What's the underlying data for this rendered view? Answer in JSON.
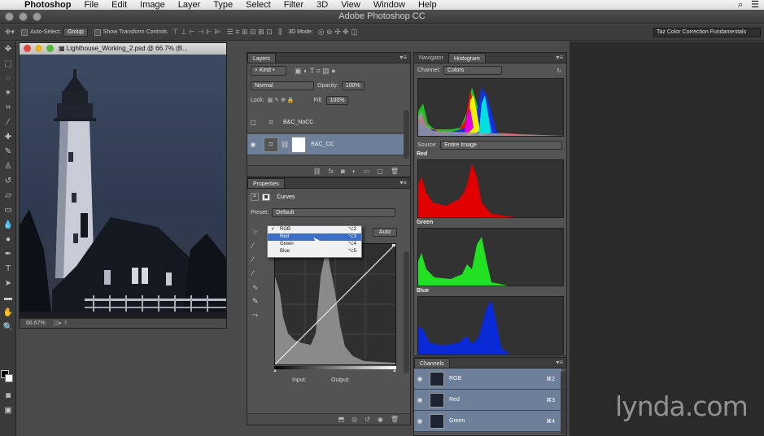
{
  "menubar": {
    "app": "Photoshop",
    "items": [
      "File",
      "Edit",
      "Image",
      "Layer",
      "Type",
      "Select",
      "Filter",
      "3D",
      "View",
      "Window",
      "Help"
    ]
  },
  "app_title": "Adobe Photoshop CC",
  "options": {
    "auto_select_label": "Auto-Select:",
    "auto_select_value": "Group",
    "transform_label": "Show Transform Controls",
    "mode_3d": "3D Mode:",
    "workspace": "Taz Color Correction Fundamentals"
  },
  "document": {
    "title": "Lighthouse_Working_2.psd @ 66.7% (B...",
    "zoom": "66.67%"
  },
  "layers_panel": {
    "tab": "Layers",
    "kind": "Kind",
    "blend_mode": "Normal",
    "opacity_label": "Opacity:",
    "opacity": "100%",
    "lock_label": "Lock:",
    "fill_label": "Fill:",
    "fill": "100%",
    "layers": [
      {
        "name": "B&C_NoCC",
        "visible": false
      },
      {
        "name": "B&C_CC",
        "visible": true
      }
    ]
  },
  "properties_panel": {
    "tab": "Properties",
    "adjustment": "Curves",
    "preset_label": "Preset:",
    "preset": "Default",
    "auto_button": "Auto",
    "input_label": "Input:",
    "output_label": "Output:",
    "channel_menu": [
      {
        "label": "RGB",
        "shortcut": "⌥2",
        "checked": true
      },
      {
        "label": "Red",
        "shortcut": "⌥3",
        "highlighted": true
      },
      {
        "label": "Green",
        "shortcut": "⌥4"
      },
      {
        "label": "Blue",
        "shortcut": "⌥5"
      }
    ]
  },
  "histogram_panel": {
    "tabs": [
      "Navigator",
      "Histogram"
    ],
    "channel_label": "Channel:",
    "channel": "Colors",
    "source_label": "Source:",
    "source": "Entire Image",
    "sections": [
      {
        "name": "Red",
        "color": "#e00000"
      },
      {
        "name": "Green",
        "color": "#22e022"
      },
      {
        "name": "Blue",
        "color": "#0a2ad8"
      }
    ]
  },
  "channels_panel": {
    "tab": "Channels",
    "rows": [
      {
        "name": "RGB",
        "shortcut": "⌘2"
      },
      {
        "name": "Red",
        "shortcut": "⌘3"
      },
      {
        "name": "Green",
        "shortcut": "⌘4"
      }
    ]
  },
  "watermark": "lynda.com"
}
